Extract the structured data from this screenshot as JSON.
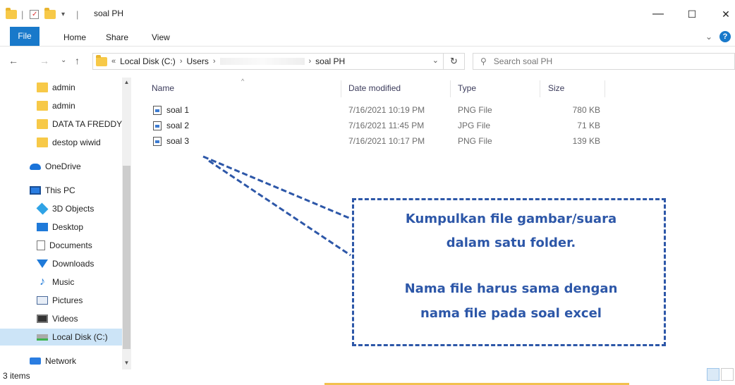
{
  "window": {
    "title": "soal PH",
    "minimize": "—",
    "maximize": "☐",
    "close": "✕"
  },
  "ribbon": {
    "tabs": [
      "File",
      "Home",
      "Share",
      "View"
    ],
    "expand": "⌄",
    "help": "?"
  },
  "address": {
    "back": "←",
    "forward": "→",
    "recent": "⌄",
    "up": "↑",
    "overflow": "«",
    "crumbs": [
      "Local Disk (C:)",
      "Users",
      "soal PH"
    ],
    "separator": "›",
    "dropdown": "⌄",
    "refresh": "↻"
  },
  "search": {
    "placeholder": "Search soal PH",
    "icon_glyph": "⚲"
  },
  "sidebar": {
    "items": [
      {
        "label": "admin",
        "icon": "folder-icon"
      },
      {
        "label": "admin",
        "icon": "folder-icon"
      },
      {
        "label": "DATA TA FREDDY",
        "icon": "folder-icon"
      },
      {
        "label": "destop wiwid",
        "icon": "folder-icon"
      },
      {
        "label": "OneDrive",
        "icon": "onedrive-icon"
      },
      {
        "label": "This PC",
        "icon": "this-pc-icon"
      },
      {
        "label": "3D Objects",
        "icon": "3d-objects-icon"
      },
      {
        "label": "Desktop",
        "icon": "desktop-icon"
      },
      {
        "label": "Documents",
        "icon": "documents-icon"
      },
      {
        "label": "Downloads",
        "icon": "downloads-icon"
      },
      {
        "label": "Music",
        "icon": "music-icon"
      },
      {
        "label": "Pictures",
        "icon": "pictures-icon"
      },
      {
        "label": "Videos",
        "icon": "videos-icon"
      },
      {
        "label": "Local Disk (C:)",
        "icon": "local-disk-icon"
      },
      {
        "label": "Network",
        "icon": "network-icon"
      }
    ],
    "selected": "Local Disk (C:)"
  },
  "filelist": {
    "headers": {
      "name": "Name",
      "date": "Date modified",
      "type": "Type",
      "size": "Size"
    },
    "sort_arrow": "^",
    "rows": [
      {
        "name": "soal 1",
        "date": "7/16/2021 10:19 PM",
        "type": "PNG File",
        "size": "780 KB"
      },
      {
        "name": "soal 2",
        "date": "7/16/2021 11:45 PM",
        "type": "JPG File",
        "size": "71 KB"
      },
      {
        "name": "soal 3",
        "date": "7/16/2021 10:17 PM",
        "type": "PNG File",
        "size": "139 KB"
      }
    ]
  },
  "status": {
    "item_count": "3 items"
  },
  "annotation": {
    "line1": "Kumpulkan file gambar/suara",
    "line2": "dalam satu folder.",
    "line3": "Nama file harus sama dengan",
    "line4": "nama file pada soal excel",
    "color": "#2d57a8"
  },
  "colors": {
    "accent": "#1979ca",
    "selection": "#cce4f7",
    "folder": "#f7c948"
  }
}
